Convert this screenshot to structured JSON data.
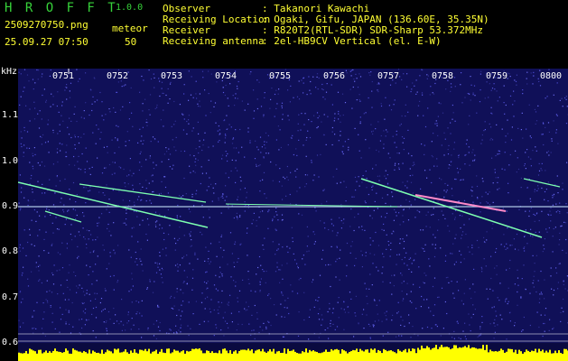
{
  "app": {
    "title": "H R O F F T",
    "version": "1.0.0",
    "mode": "meteor",
    "count": "50"
  },
  "file": {
    "name": "2509270750.png",
    "datetime": "25.09.27 07:50"
  },
  "info": {
    "labels": [
      "Observer",
      "Receiving Location",
      "Receiver",
      "Receiving antenna"
    ],
    "values": [
      ": Takanori Kawachi",
      ": Ogaki, Gifu, JAPAN (136.60E, 35.35N)",
      ": R820T2(RTL-SDR) SDR-Sharp 53.372MHz",
      ": 2el-HB9CV Vertical (el. E-W)"
    ]
  },
  "axis": {
    "unit": "kHz",
    "y_ticks": [
      "1.1",
      "1.0",
      "0.9",
      "0.8",
      "0.7",
      "0.6"
    ],
    "x_ticks": [
      "0751",
      "0752",
      "0753",
      "0754",
      "0755",
      "0756",
      "0757",
      "0758",
      "0759",
      "0800"
    ]
  },
  "colors": {
    "background": "#000000",
    "title_green": "#37d23a",
    "label_yellow": "#ffff33",
    "spectrogram_bg": "#101058",
    "carrier": "#c8e8ff",
    "echo": "#7dffb0",
    "level_bar": "#ffff00"
  }
}
